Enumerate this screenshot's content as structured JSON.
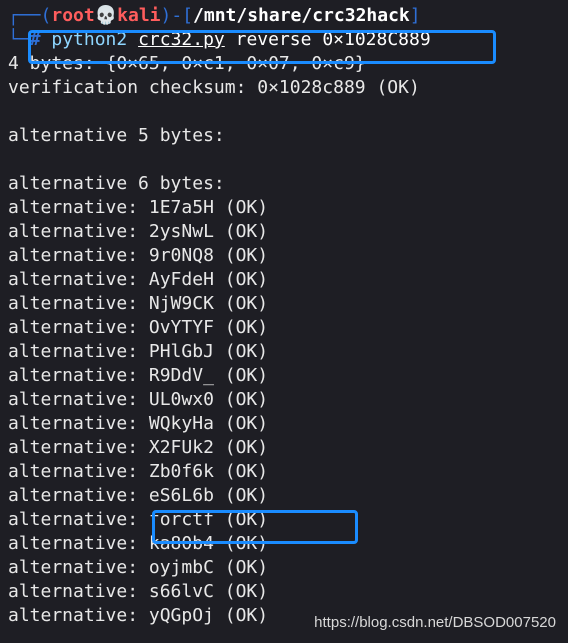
{
  "prompt": {
    "open": "┌──(",
    "user": "root",
    "skull": "💀",
    "host": "kali",
    "mid": ")-[",
    "path": "/mnt/share/crc32hack",
    "close": "]",
    "corner": "└─",
    "hash": "#",
    "command": "python2",
    "file": "crc32.py",
    "args": "reverse 0×1028C889"
  },
  "output": [
    "4 bytes: {0×65, 0×c1, 0×07, 0×c9}",
    "verification checksum: 0×1028c889 (OK)",
    "",
    "alternative 5 bytes:",
    "",
    "alternative 6 bytes:",
    "alternative: 1E7a5H (OK)",
    "alternative: 2ysNwL (OK)",
    "alternative: 9r0NQ8 (OK)",
    "alternative: AyFdeH (OK)",
    "alternative: NjW9CK (OK)",
    "alternative: OvYTYF (OK)",
    "alternative: PHlGbJ (OK)",
    "alternative: R9DdV_ (OK)",
    "alternative: UL0wx0 (OK)",
    "alternative: WQkyHa (OK)",
    "alternative: X2FUk2 (OK)",
    "alternative: Zb0f6k (OK)",
    "alternative: eS6L6b (OK)",
    "alternative: forctf (OK)",
    "alternative: ka80b4 (OK)",
    "alternative: oyjmbC (OK)",
    "alternative: s66lvC (OK)",
    "alternative: yQGpOj (OK)"
  ],
  "watermark": "https://blog.csdn.net/DBSOD007520",
  "colors": {
    "background": "#1e1e24",
    "highlight": "#1a8cff",
    "prompt_user": "#ff5d5d",
    "prompt_frame": "#2f6fd6"
  }
}
